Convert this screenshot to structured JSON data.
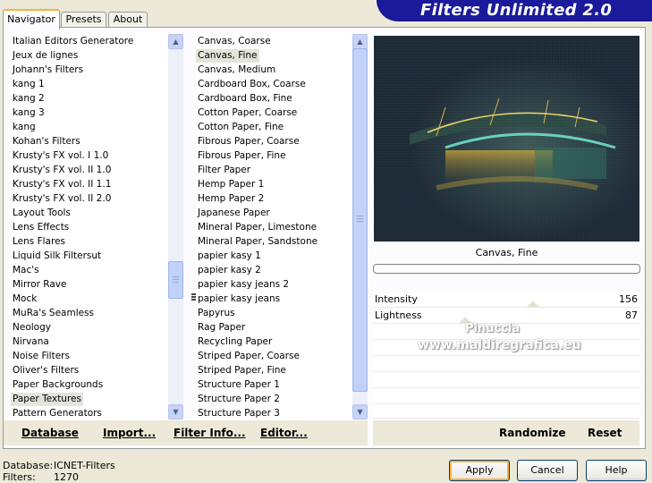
{
  "tabs": [
    "Navigator",
    "Presets",
    "About"
  ],
  "banner_title": "Filters Unlimited 2.0",
  "categories": [
    "Italian Editors Generatore",
    "Jeux de lignes",
    "Johann's Filters",
    "kang 1",
    "kang 2",
    "kang 3",
    "kang",
    "Kohan's Filters",
    "Krusty's FX vol. I 1.0",
    "Krusty's FX vol. II 1.0",
    "Krusty's FX vol. II 1.1",
    "Krusty's FX vol. II 2.0",
    "Layout Tools",
    "Lens Effects",
    "Lens Flares",
    "Liquid Silk Filtersut",
    "Mac's",
    "Mirror Rave",
    "Mock",
    "MuRa's Seamless",
    "Neology",
    "Nirvana",
    "Noise Filters",
    "Oliver's Filters",
    "Paper Backgrounds",
    "Paper Textures",
    "Pattern Generators"
  ],
  "selected_category": "Paper Textures",
  "filters": [
    "Canvas, Coarse",
    "Canvas, Fine",
    "Canvas, Medium",
    "Cardboard Box, Coarse",
    "Cardboard Box, Fine",
    "Cotton Paper, Coarse",
    "Cotton Paper, Fine",
    "Fibrous Paper, Coarse",
    "Fibrous Paper, Fine",
    "Filter Paper",
    "Hemp Paper 1",
    "Hemp Paper 2",
    "Japanese Paper",
    "Mineral Paper, Limestone",
    "Mineral Paper, Sandstone",
    "papier kasy 1",
    "papier kasy 2",
    "papier kasy jeans 2",
    "papier kasy jeans",
    "Papyrus",
    "Rag Paper",
    "Recycling Paper",
    "Striped Paper, Coarse",
    "Striped Paper, Fine",
    "Structure Paper 1",
    "Structure Paper 2",
    "Structure Paper 3"
  ],
  "selected_filter": "Canvas, Fine",
  "preview_caption": "Canvas, Fine",
  "params": [
    {
      "name": "Intensity",
      "value": "156",
      "level": 0.61
    },
    {
      "name": "Lightness",
      "value": "87",
      "level": 0.34
    }
  ],
  "watermark": {
    "line1": "Pinuccia",
    "line2": "www.maldiregrafica.eu"
  },
  "bottom_links": {
    "database": "Database",
    "import": "Import...",
    "filter_info": "Filter Info...",
    "editor": "Editor..."
  },
  "right_buttons": {
    "randomize": "Randomize",
    "reset": "Reset"
  },
  "status": {
    "database_label": "Database:",
    "database_value": "ICNET-Filters",
    "filters_label": "Filters:",
    "filters_value": "1270"
  },
  "dialog_buttons": {
    "apply": "Apply",
    "cancel": "Cancel",
    "help": "Help"
  },
  "icons": {
    "scroll_up": "scroll-up-icon",
    "scroll_down": "scroll-down-icon"
  }
}
